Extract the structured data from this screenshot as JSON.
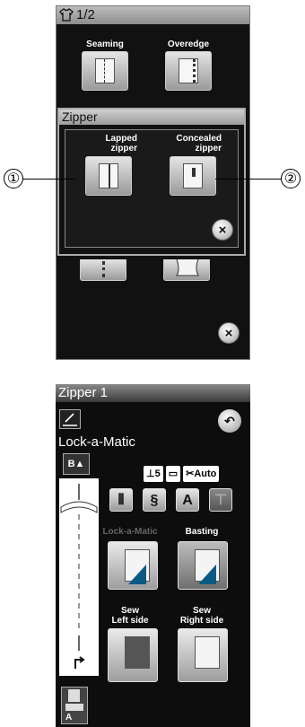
{
  "screen1": {
    "header": {
      "page": "1/2",
      "icon": "shirt-icon"
    },
    "categories": [
      {
        "label": "Seaming"
      },
      {
        "label": "Overedge"
      }
    ],
    "zipper_popup": {
      "title": "Zipper",
      "options": [
        {
          "label_line1": "Lapped",
          "label_line2": "zipper"
        },
        {
          "label_line1": "Concealed",
          "label_line2": "zipper"
        }
      ]
    },
    "callouts": [
      "①",
      "②"
    ],
    "close_glyph": "×"
  },
  "screen2": {
    "header": {
      "title": "Zipper 1"
    },
    "pattern_name": "Lock-a-Matic",
    "selector_label": "B",
    "status": {
      "foot_height": "5",
      "auto_label": "Auto"
    },
    "icon_row": [
      "A"
    ],
    "modes": [
      {
        "label": "Lock-a-Matic",
        "active": false
      },
      {
        "label": "Basting",
        "active": true
      }
    ],
    "sew_modes": [
      {
        "line1": "Sew",
        "line2": "Left side"
      },
      {
        "line1": "Sew",
        "line2": "Right side"
      }
    ],
    "presser_foot": "A"
  }
}
